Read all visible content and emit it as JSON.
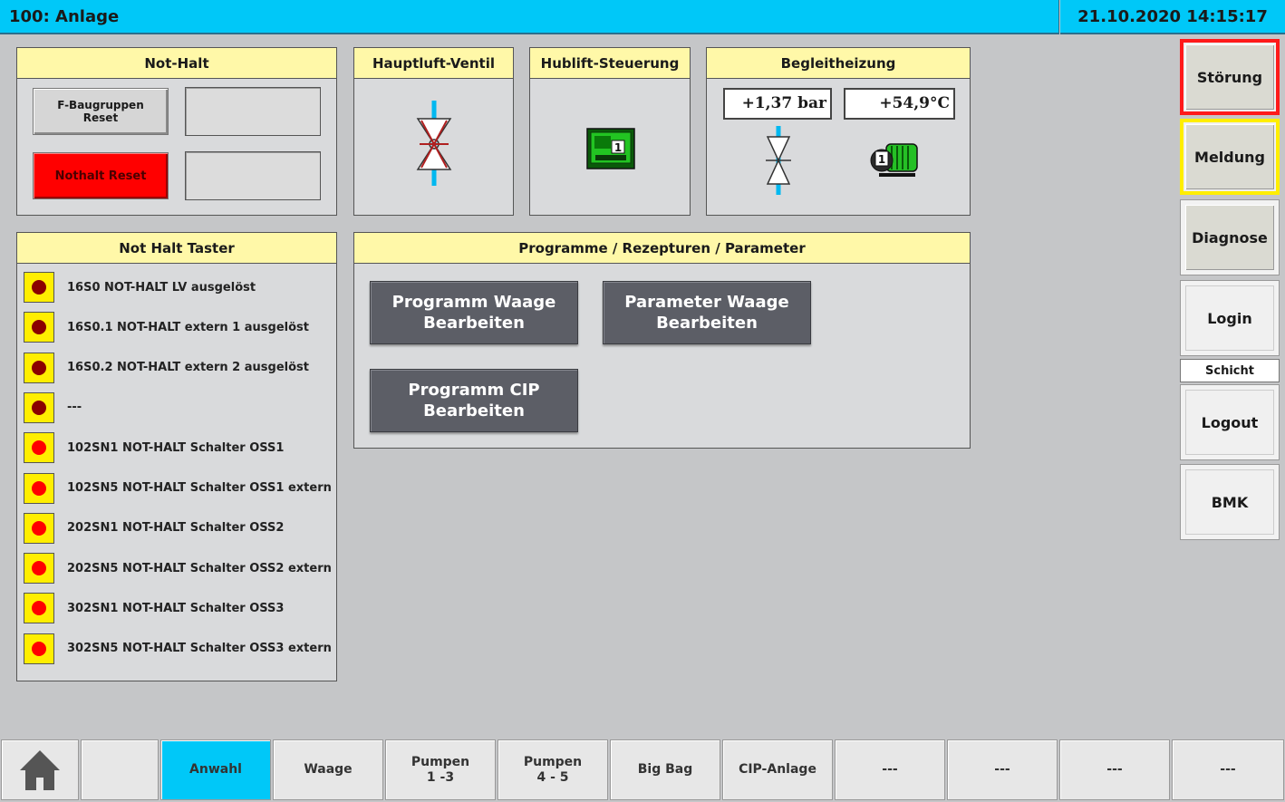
{
  "header": {
    "title": "100: Anlage",
    "datetime": "21.10.2020 14:15:17"
  },
  "not_halt": {
    "title": "Not-Halt",
    "f_reset_label": "F-Baugruppen\nReset",
    "nothalt_reset_label": "Nothalt Reset"
  },
  "hauptluft": {
    "title": "Hauptluft-Ventil",
    "icon": "valve-icon"
  },
  "hublift": {
    "title": "Hublift-Steuerung",
    "icon": "controller-icon"
  },
  "begleitheizung": {
    "title": "Begleitheizung",
    "pressure": "+1,37 bar",
    "temperature": "+54,9°C"
  },
  "taster": {
    "title": "Not Halt Taster",
    "items": [
      {
        "label": "16S0 NOT-HALT LV ausgelöst",
        "color": "#8b0000"
      },
      {
        "label": "16S0.1 NOT-HALT extern 1 ausgelöst",
        "color": "#8b0000"
      },
      {
        "label": "16S0.2 NOT-HALT extern 2 ausgelöst",
        "color": "#8b0000"
      },
      {
        "label": "---",
        "color": "#8b0000"
      },
      {
        "label": "102SN1 NOT-HALT Schalter OSS1",
        "color": "#ff0000"
      },
      {
        "label": "102SN5 NOT-HALT Schalter OSS1 extern",
        "color": "#ff0000"
      },
      {
        "label": "202SN1 NOT-HALT Schalter OSS2",
        "color": "#ff0000"
      },
      {
        "label": "202SN5 NOT-HALT Schalter OSS2 extern",
        "color": "#ff0000"
      },
      {
        "label": "302SN1 NOT-HALT Schalter OSS3",
        "color": "#ff0000"
      },
      {
        "label": "302SN5 NOT-HALT Schalter OSS3 extern",
        "color": "#ff0000"
      }
    ]
  },
  "programme": {
    "title": "Programme / Rezepturen / Parameter",
    "waage_prog": "Programm Waage\nBearbeiten",
    "waage_param": "Parameter Waage\nBearbeiten",
    "cip_prog": "Programm CIP\nBearbeiten"
  },
  "sidebar": {
    "stoerung": "Störung",
    "meldung": "Meldung",
    "diagnose": "Diagnose",
    "login": "Login",
    "schicht": "Schicht",
    "logout": "Logout",
    "bmk": "BMK"
  },
  "nav": {
    "home_icon": "home-icon",
    "blank": "",
    "anwahl": "Anwahl",
    "waage": "Waage",
    "pumpen13": "Pumpen\n1 -3",
    "pumpen45": "Pumpen\n4 - 5",
    "bigbag": "Big Bag",
    "cip": "CIP-Anlage",
    "d1": "---",
    "d2": "---",
    "d3": "---",
    "d4": "---"
  },
  "colors": {
    "header": "#00c8f8",
    "title_bg": "#fff8a8",
    "alarm": "#ff0000",
    "warning": "#ffee00"
  }
}
